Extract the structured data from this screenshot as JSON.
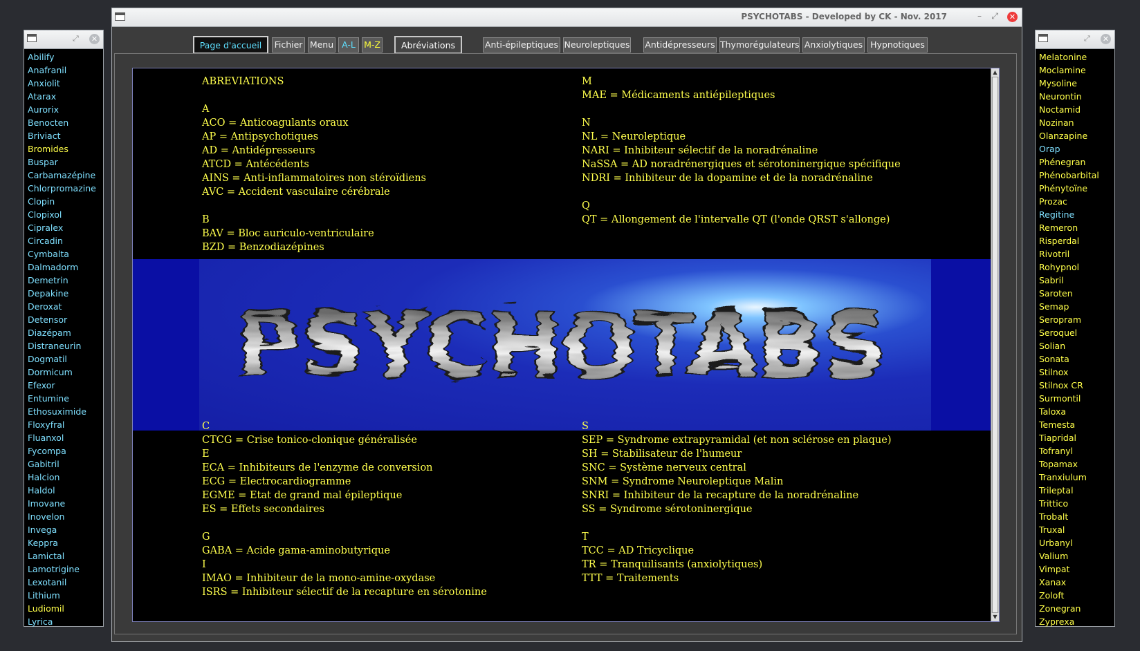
{
  "left_list": [
    "Abilify",
    "Anafranil",
    "Anxiolit",
    "Atarax",
    "Aurorix",
    "Benocten",
    "Briviact",
    "Bromides",
    "Buspar",
    "Carbamazépine",
    "Chlorpromazine",
    "Clopin",
    "Clopixol",
    "Cipralex",
    "Circadin",
    "Cymbalta",
    "Dalmadorm",
    "Demetrin",
    "Depakine",
    "Deroxat",
    "Detensor",
    "Diazépam",
    "Distraneurin",
    "Dogmatil",
    "Dormicum",
    "Efexor",
    "Entumine",
    "Ethosuximide",
    "Floxyfral",
    "Fluanxol",
    "Fycompa",
    "Gabitril",
    "Halcion",
    "Haldol",
    "Imovane",
    "Inovelon",
    "Invega",
    "Keppra",
    "Lamictal",
    "Lamotrigine",
    "Lexotanil",
    "Lithium",
    "Ludiomil",
    "Lyrica"
  ],
  "right_list": [
    "Melatonine",
    "Moclamine",
    "Mysoline",
    "Neurontin",
    "Noctamid",
    "Nozinan",
    "Olanzapine",
    "Orap",
    "Phénegran",
    "Phénobarbital",
    "Phénytoïne",
    "Prozac",
    "Regitine",
    "Remeron",
    "Risperdal",
    "Rivotril",
    "Rohypnol",
    "Sabril",
    "Saroten",
    "Semap",
    "Seropram",
    "Seroquel",
    "Solian",
    "Sonata",
    "Stilnox",
    "Stilnox CR",
    "Surmontil",
    "Taloxa",
    "Temesta",
    "Tiapridal",
    "Tofranyl",
    "Topamax",
    "Tranxiulum",
    "Trileptal",
    "Trittico",
    "Trobalt",
    "Truxal",
    "Urbanyl",
    "Valium",
    "Vimpat",
    "Xanax",
    "Zoloft",
    "Zonegran",
    "Zyprexa"
  ],
  "window": {
    "title": "PSYCHOTABS - Developed by CK - Nov. 2017"
  },
  "toolbar": {
    "home": "Page d'accueil",
    "fichier": "Fichier",
    "menu": "Menu",
    "al": "A-L",
    "mz": "M-Z",
    "abreviations": "Abréviations",
    "antiepileptiques": "Anti-épileptiques",
    "neuroleptiques": "Neuroleptiques",
    "antidepresseurs": "Antidépresseurs",
    "thymoregulateurs": "Thymorégulateurs",
    "anxiolytiques": "Anxiolytiques",
    "hypnotiques": "Hypnotiques"
  },
  "content": {
    "top_left": [
      "ABREVIATIONS",
      "",
      "A",
      "ACO = Anticoagulants oraux",
      "AP = Antipsychotiques",
      "AD = Antidépresseurs",
      "ATCD = Antécédents",
      "AINS = Anti-inflammatoires non stéroïdiens",
      "AVC = Accident vasculaire cérébrale",
      "",
      "B",
      "BAV = Bloc auriculo-ventriculaire",
      "BZD = Benzodiazépines"
    ],
    "top_right": [
      "M",
      "MAE  = Médicaments antiépileptiques",
      "",
      "N",
      "NL = Neuroleptique",
      "NARI = Inhibiteur sélectif de la noradrénaline",
      "NaSSA = AD noradrénergiques et sérotoninergique spécifique",
      "NDRI = Inhibiteur de la dopamine et de la noradrénaline",
      "",
      "Q",
      "QT = Allongement de l'intervalle QT (l'onde QRST s'allonge)"
    ],
    "bottom_left": [
      "C",
      "CTCG = Crise tonico-clonique généralisée",
      "E",
      "ECA = Inhibiteurs de l'enzyme de conversion",
      "ECG = Electrocardiogramme",
      "EGME = Etat de grand mal épileptique",
      "ES = Effets secondaires",
      "",
      "G",
      "GABA = Acide gama-aminobutyrique",
      "I",
      "IMAO = Inhibiteur de la mono-amine-oxydase",
      "ISRS = Inhibiteur sélectif de la recapture en sérotonine"
    ],
    "bottom_right": [
      "S",
      "SEP = Syndrome extrapyramidal (et non sclérose en plaque)",
      "SH = Stabilisateur de l'humeur",
      "SNC = Système nerveux central",
      "SNM = Syndrome Neuroleptique Malin",
      "SNRI = Inhibiteur de la recapture de la noradrénaline",
      "SS = Syndrome sérotoninergique",
      "",
      "T",
      "TCC = AD Tricyclique",
      "TR = Tranquilisants (anxiolytiques)",
      "TTT = Traitements"
    ],
    "banner_text": "PSYCHOTABS"
  },
  "colors": {
    "cyan": "#7fe0ff",
    "yellow": "#ffff4d",
    "banner_blue": "#0a0fa4"
  },
  "yellow_items_left": [
    "Bromides",
    "Ludiomil"
  ],
  "cyan_items_right": [
    "Orap",
    "Regitine"
  ]
}
